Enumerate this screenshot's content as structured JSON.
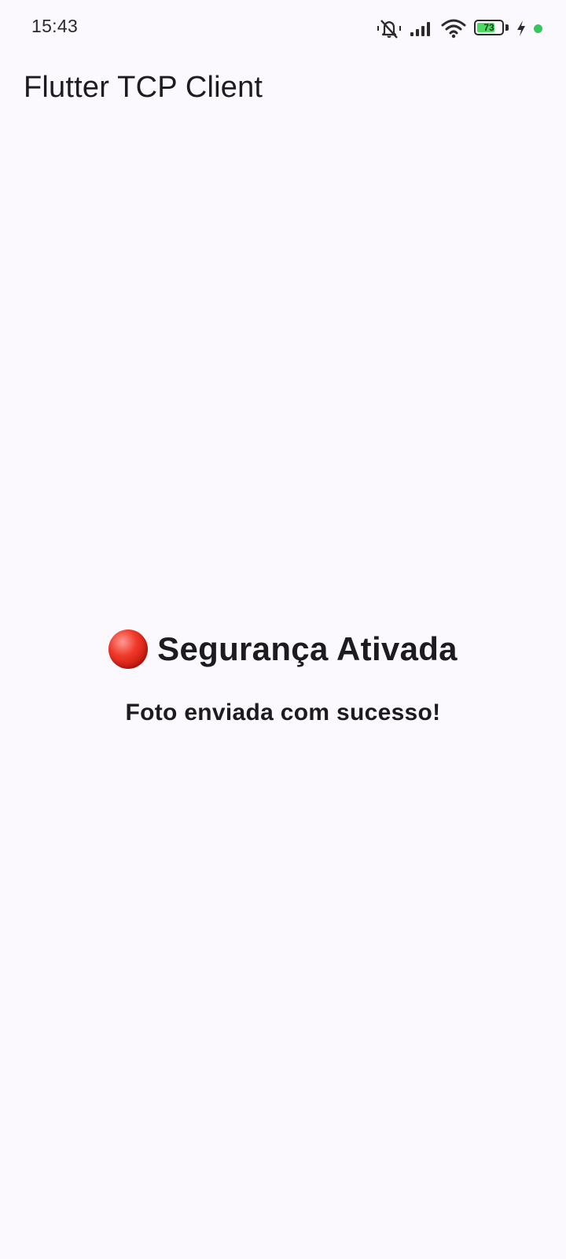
{
  "status_bar": {
    "time": "15:43",
    "battery_level": "73",
    "icons": [
      "mute-vibrate-icon",
      "signal-icon",
      "wifi-icon",
      "battery-icon",
      "charging-bolt-icon",
      "active-dot-icon"
    ],
    "battery_fill_color": "#4cd964",
    "dot_color": "#34c759"
  },
  "app_bar": {
    "title": "Flutter TCP Client"
  },
  "main": {
    "status_icon": "red-circle-icon",
    "status_icon_color": "#e53935",
    "heading": "Segurança Ativada",
    "message": "Foto enviada com sucesso!"
  },
  "theme": {
    "background": "#fbf8fe",
    "text": "#1c1b1f"
  }
}
